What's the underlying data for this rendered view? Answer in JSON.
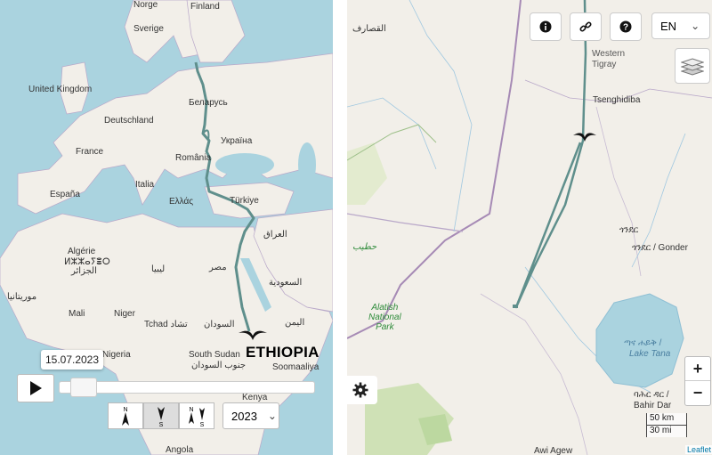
{
  "left_map": {
    "labels": {
      "norge": "Norge",
      "finland": "Finland",
      "sverige": "Sverige",
      "united_kingdom": "United Kingdom",
      "belarus": "Беларусь",
      "deutschland": "Deutschland",
      "ukraina": "Україна",
      "france": "France",
      "romania": "România",
      "italia": "Italia",
      "espana": "España",
      "ellas": "Ελλάς",
      "turkiye": "Türkiye",
      "algerie": "Algérie",
      "algerie_tifinagh": "ⵍⵣⵣⴰⵢⴻⵔ",
      "algerie_ar": "الجزائر",
      "libya": "ليبيا",
      "misr": "مصر",
      "iraq": "العراق",
      "saudi": "السعودية",
      "mauritania": "موريتانيا",
      "mali": "Mali",
      "niger": "Niger",
      "tchad": "Tchad تشاد",
      "sudan": "السودان",
      "yemen": "اليمن",
      "nigeria": "Nigeria",
      "south_sudan": "South Sudan",
      "south_sudan_ar": "جنوب السودان",
      "somaaliya": "Soomaaliya",
      "kenya": "Kenya",
      "angola": "Angola"
    },
    "destination_title": "ETHIOPIA"
  },
  "right_map": {
    "labels": {
      "qusayr": "القصارف",
      "western_tigray": "Western\nTigray",
      "tsenghidiba": "Tsenghidiba",
      "gonder_am": "ጎንደር",
      "gonder": "ጎንደር / Gonder",
      "hateeb": "حطيب",
      "alatish": "Alatish\nNational\nPark",
      "lake_tana_am": "ጣና ሐይቅ /",
      "lake_tana": "Lake Tana",
      "bahir_dar_am": "ባሕር ዳር /",
      "bahir_dar": "Bahir Dar",
      "awi_agew": "Awi Agew"
    }
  },
  "playback": {
    "date": "15.07.2023",
    "progress": 0.05,
    "year": "2023",
    "year_arrow": "⌄"
  },
  "direction_buttons": [
    {
      "top": "N",
      "bottom": "",
      "active": false
    },
    {
      "top": "",
      "bottom": "S",
      "active": true
    },
    {
      "top": "N",
      "bottom": "S",
      "active": false
    }
  ],
  "toolbar": {
    "info_icon": "info-icon",
    "link_icon": "link-icon",
    "help_icon": "help-icon",
    "language": "EN",
    "lang_arrow": "⌄"
  },
  "zoom": {
    "in": "+",
    "out": "−"
  },
  "scale": {
    "metric": "50 km",
    "imperial": "30 mi"
  },
  "attribution": "Leaflet",
  "colors": {
    "track": "#5f8f8c",
    "water": "#aad3df",
    "land": "#f2efe9"
  }
}
